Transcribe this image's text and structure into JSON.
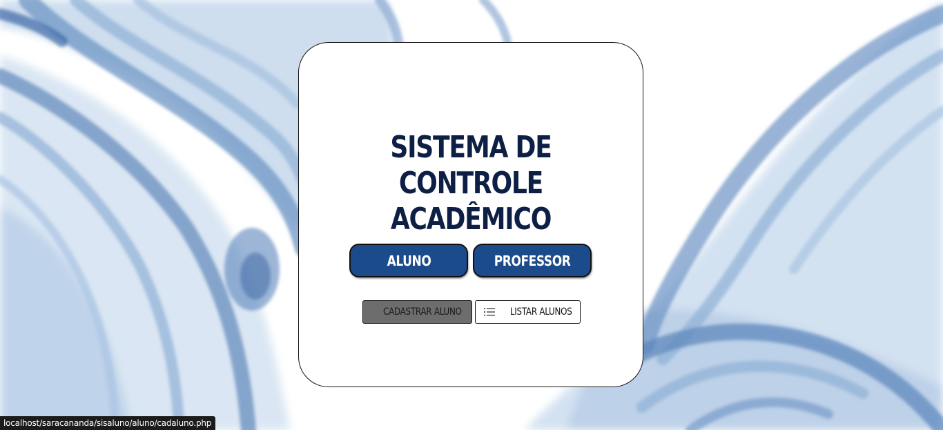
{
  "header": {
    "title_line1": "SISTEMA DE CONTROLE",
    "title_line2": "ACADÊMICO"
  },
  "nav": {
    "aluno_label": "ALUNO",
    "professor_label": "PROFESSOR"
  },
  "actions": {
    "cadastrar_label": "CADASTRAR ALUNO",
    "listar_label": "LISTAR ALUNOS",
    "listar_icon": "list-icon"
  },
  "status": {
    "url": "localhost/saracananda/sisaluno/aluno/cadaluno.php"
  },
  "colors": {
    "title": "#0e1f45",
    "primary_button": "#1c4b8b",
    "cadastrar_bg": "#6d6d6d",
    "background_wash": "#7fa3cf"
  }
}
